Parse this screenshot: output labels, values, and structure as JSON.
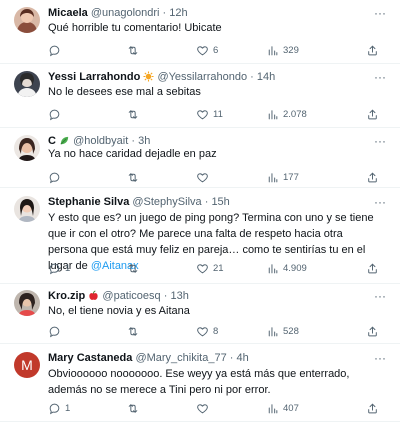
{
  "tweets": [
    {
      "name": "Micaela",
      "handle": "@unagolondri",
      "dot": "·",
      "time": "12h",
      "text": "Qué horrible tu comentario! Ubicate",
      "replies": "",
      "retweets": "",
      "likes": "6",
      "views": "329"
    },
    {
      "name": "Yessi Larrahondo",
      "handle": "@Yessilarrahondo",
      "dot": "·",
      "time": "14h",
      "text": "No le desees ese mal a sebitas",
      "replies": "",
      "retweets": "",
      "likes": "11",
      "views": "2.078"
    },
    {
      "name": "C",
      "handle": "@holdbyait",
      "dot": "·",
      "time": "3h",
      "text": "Ya no hace caridad dejadle en paz",
      "replies": "",
      "retweets": "",
      "likes": "",
      "views": "177"
    },
    {
      "name": "Stephanie Silva",
      "handle": "@StephySilva",
      "dot": "·",
      "time": "15h",
      "text": "Y esto que es? un juego de ping pong? Termina con uno y se tiene que ir con el otro? Me parece una falta de respeto hacia otra persona que está muy feliz en pareja… como te sentirías tu en el lugar de ",
      "mention": "@Aitanax",
      "replies": "1",
      "retweets": "",
      "likes": "21",
      "views": "4.909"
    },
    {
      "name": "Kro.zip",
      "handle": "@paticoesq",
      "dot": "·",
      "time": "13h",
      "text": "No, el tiene novia y es Aitana",
      "replies": "",
      "retweets": "",
      "likes": "8",
      "views": "528"
    },
    {
      "name": "Mary Castaneda",
      "handle": "@Mary_chikita_77",
      "dot": "·",
      "time": "4h",
      "text": "Obvioooooo nooooooo. Ese weyy ya está más que enterrado, además no se merece a Tini pero ni por error.",
      "avatar_letter": "M",
      "replies": "1",
      "retweets": "",
      "likes": "",
      "views": "407"
    }
  ],
  "more_label": "···",
  "colors": {
    "text": "#0f1419",
    "muted": "#536471",
    "link": "#1d9bf0",
    "divider": "#eff3f4",
    "avatar_m": "#c1392b"
  },
  "icons": [
    "reply-icon",
    "retweet-icon",
    "like-icon",
    "views-icon",
    "share-icon",
    "more-icon",
    "sun-emoji-icon",
    "leaf-emoji-icon",
    "apple-emoji-icon"
  ]
}
